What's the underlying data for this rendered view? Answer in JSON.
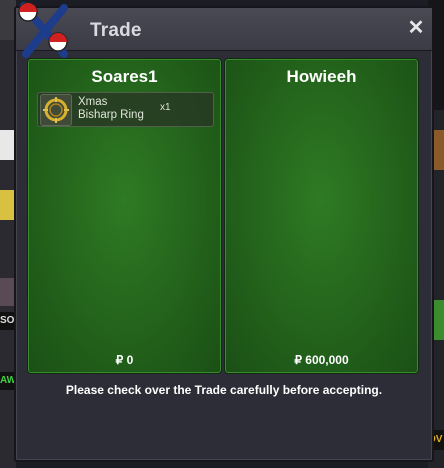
{
  "window": {
    "title": "Trade",
    "close_symbol": "✕"
  },
  "traders": [
    {
      "name": "Soares1",
      "money": "₽ 0",
      "items": [
        {
          "name_line1": "Xmas",
          "name_line2": "Bisharp Ring",
          "quantity": "x1",
          "icon": "ring-icon"
        }
      ]
    },
    {
      "name": "Howieeh",
      "money": "₽ 600,000",
      "items": []
    }
  ],
  "footer": {
    "notice": "Please check over the Trade carefully before accepting."
  },
  "background": {
    "left_labels": [
      "SO",
      "AW"
    ],
    "right_labels": [
      "OV"
    ]
  },
  "colors": {
    "panel_green": "#23631b",
    "window_bg": "#2d2d37",
    "titlebar": "#3b3b45"
  }
}
